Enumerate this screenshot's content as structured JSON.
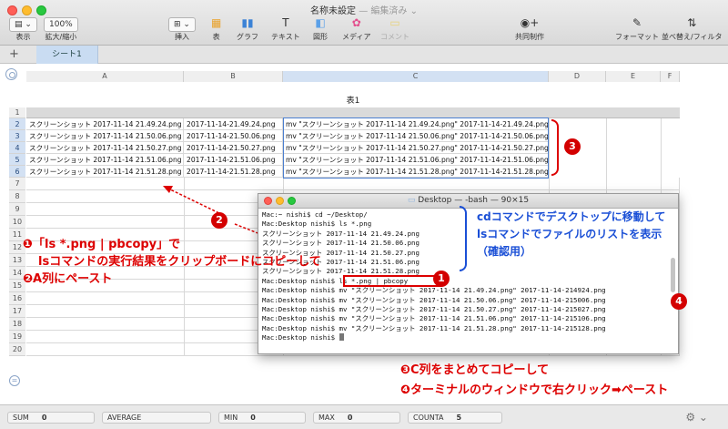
{
  "window": {
    "title": "名称未設定",
    "subtitle": "— 編集済み ⌄"
  },
  "toolbar": {
    "view_label": "表示",
    "zoom_value": "100%",
    "zoom_label": "拡大/縮小",
    "insert_label": "挿入",
    "table_label": "表",
    "chart_label": "グラフ",
    "text_label": "テキスト",
    "shape_label": "図形",
    "media_label": "メディア",
    "comment_label": "コメント",
    "collab_label": "共同制作",
    "format_label": "フォーマット",
    "sort_label": "並べ替え/フィルタ"
  },
  "tabs": {
    "sheet1": "シート1",
    "add": "+"
  },
  "table": {
    "title": "表1",
    "columns": [
      "A",
      "B",
      "C",
      "D",
      "E",
      "F"
    ],
    "rows": [
      [
        "スクリーンショット 2017-11-14 21.49.24.png",
        "2017-11-14-21.49.24.png",
        "mv \"スクリーンショット 2017-11-14 21.49.24.png\" 2017-11-14-21.49.24.png"
      ],
      [
        "スクリーンショット 2017-11-14 21.50.06.png",
        "2017-11-14-21.50.06.png",
        "mv \"スクリーンショット 2017-11-14 21.50.06.png\" 2017-11-14-21.50.06.png"
      ],
      [
        "スクリーンショット 2017-11-14 21.50.27.png",
        "2017-11-14-21.50.27.png",
        "mv \"スクリーンショット 2017-11-14 21.50.27.png\" 2017-11-14-21.50.27.png"
      ],
      [
        "スクリーンショット 2017-11-14 21.51.06.png",
        "2017-11-14-21.51.06.png",
        "mv \"スクリーンショット 2017-11-14 21.51.06.png\" 2017-11-14-21.51.06.png"
      ],
      [
        "スクリーンショット 2017-11-14 21.51.28.png",
        "2017-11-14-21.51.28.png",
        "mv \"スクリーンショット 2017-11-14 21.51.28.png\" 2017-11-14-21.51.28.png"
      ]
    ]
  },
  "terminal": {
    "title": "Desktop — -bash — 90×15",
    "lines": [
      "Mac:~ nishi$ cd ~/Desktop/",
      "Mac:Desktop nishi$ ls *.png",
      "スクリーンショット 2017-11-14 21.49.24.png",
      "スクリーンショット 2017-11-14 21.50.06.png",
      "スクリーンショット 2017-11-14 21.50.27.png",
      "スクリーンショット 2017-11-14 21.51.06.png",
      "スクリーンショット 2017-11-14 21.51.28.png",
      "Mac:Desktop nishi$ ls *.png | pbcopy",
      "Mac:Desktop nishi$ mv \"スクリーンショット 2017-11-14 21.49.24.png\" 2017-11-14-214924.png",
      "Mac:Desktop nishi$ mv \"スクリーンショット 2017-11-14 21.50.06.png\" 2017-11-14-215006.png",
      "Mac:Desktop nishi$ mv \"スクリーンショット 2017-11-14 21.50.27.png\" 2017-11-14-215027.png",
      "Mac:Desktop nishi$ mv \"スクリーンショット 2017-11-14 21.51.06.png\" 2017-11-14-215106.png",
      "Mac:Desktop nishi$ mv \"スクリーンショット 2017-11-14 21.51.28.png\" 2017-11-14-215128.png",
      "Mac:Desktop nishi$ "
    ]
  },
  "annotations": {
    "step1_line1": "❶「ls *.png | pbcopy」で",
    "step1_line2": "lsコマンドの実行結果をクリップボードにコピーして",
    "step2": "❷A列にペースト",
    "note_line1": "cdコマンドでデスクトップに移動して",
    "note_line2": "lsコマンドでファイルのリストを表示",
    "note_line3": "（確認用）",
    "step3": "❸C列をまとめてコピーして",
    "step4": "❹ターミナルのウィンドウで右クリック➡ペースト",
    "badge1": "1",
    "badge2": "2",
    "badge3": "3",
    "badge4": "4"
  },
  "status": {
    "sum_label": "SUM",
    "sum_value": "0",
    "avg_label": "AVERAGE",
    "min_label": "MIN",
    "min_value": "0",
    "max_label": "MAX",
    "max_value": "0",
    "counta_label": "COUNTA",
    "counta_value": "5"
  },
  "colors": {
    "accent": "#4b7fd0",
    "annotation_red": "#d30000",
    "annotation_blue": "#1a4fd6"
  }
}
